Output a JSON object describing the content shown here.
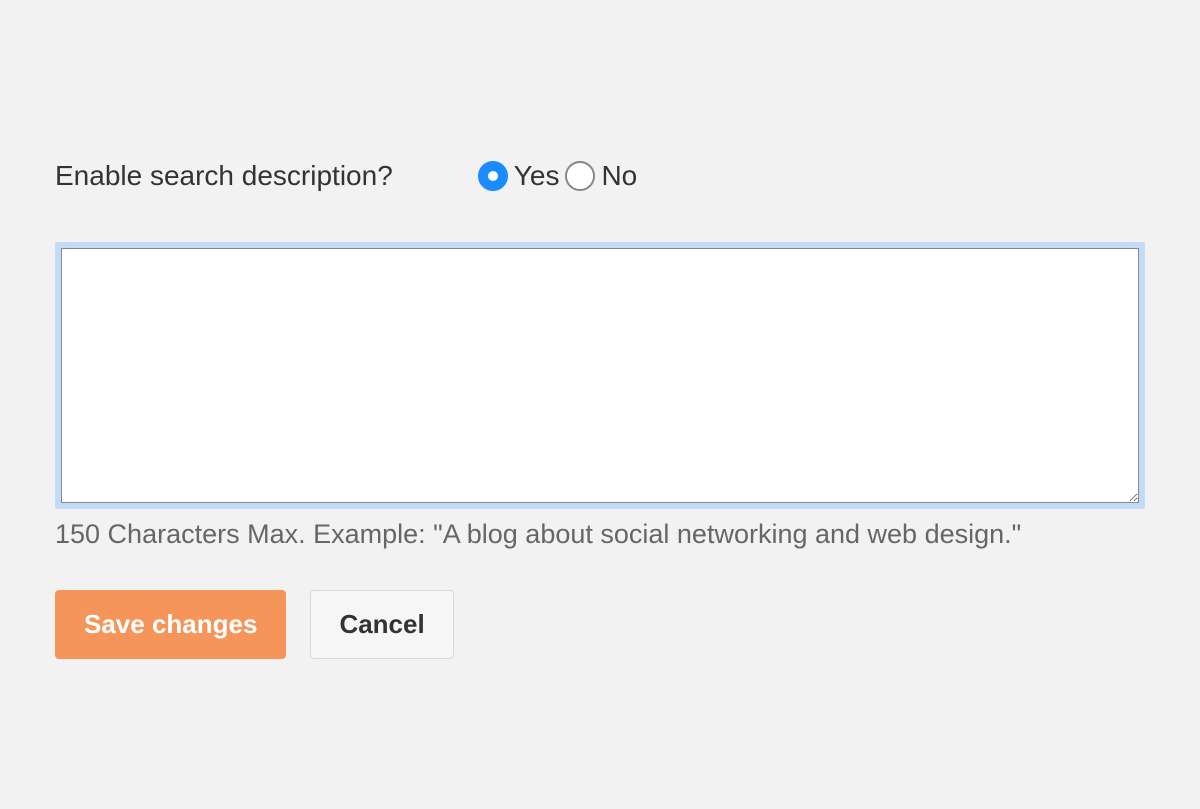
{
  "form": {
    "label": "Enable search description?",
    "options": {
      "yes": "Yes",
      "no": "No"
    },
    "selected": "yes",
    "textarea_value": "",
    "help_text": "150 Characters Max. Example: \"A blog about social networking and web design.\""
  },
  "buttons": {
    "save": "Save changes",
    "cancel": "Cancel"
  }
}
